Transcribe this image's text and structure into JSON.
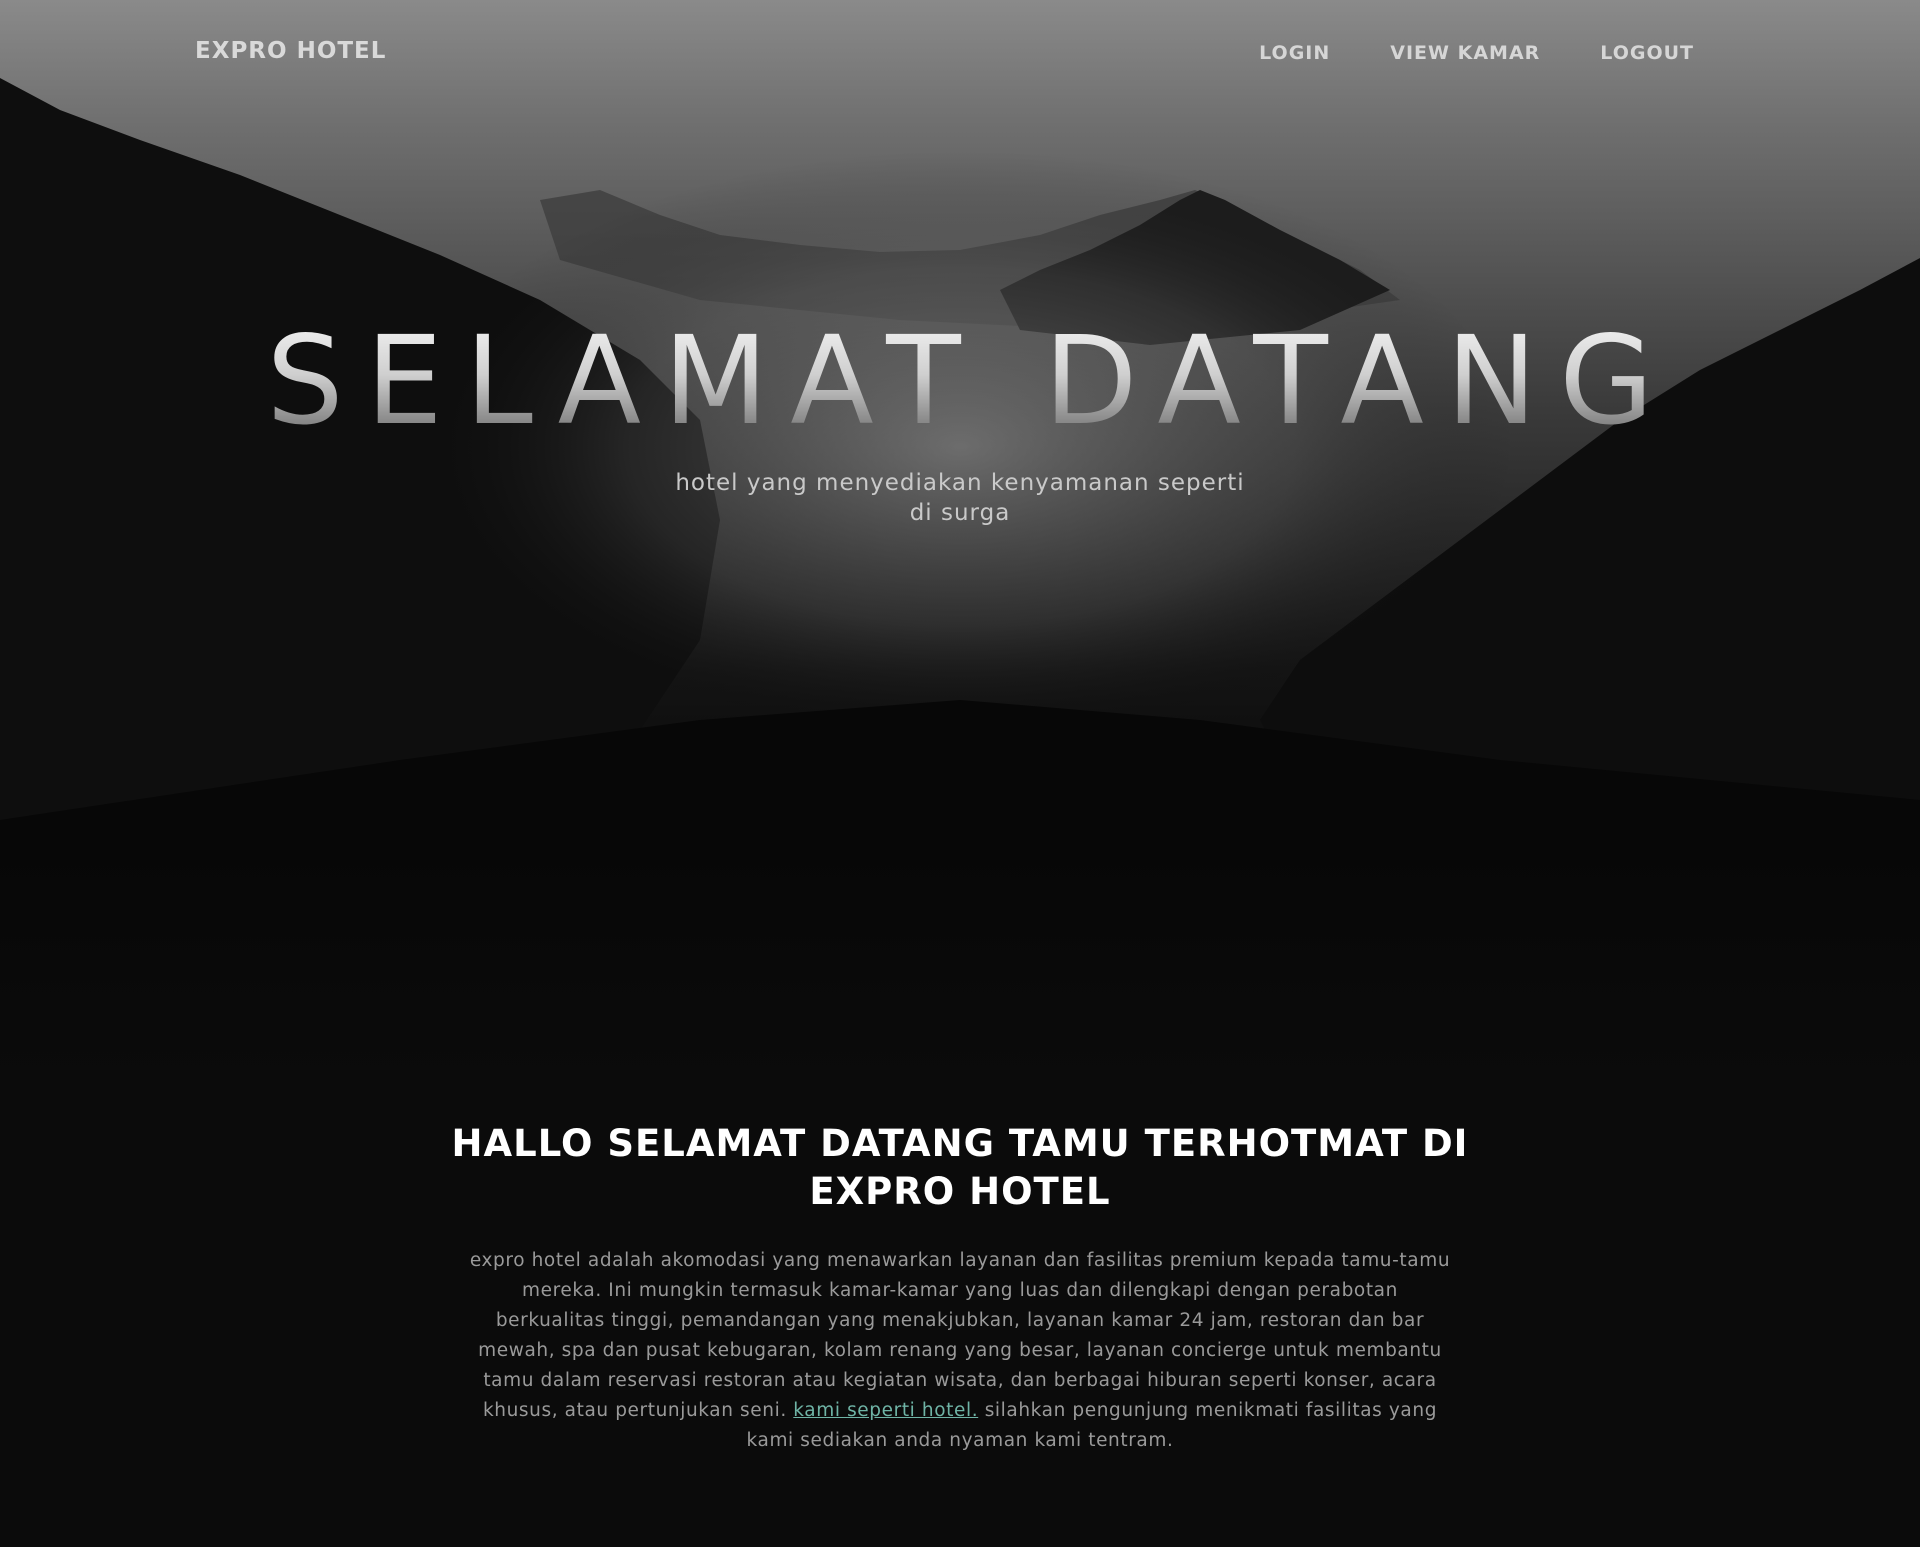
{
  "nav": {
    "brand": "EXPRO HOTEL",
    "links": [
      {
        "label": "LOGIN"
      },
      {
        "label": "VIEW KAMAR"
      },
      {
        "label": "LOGOUT"
      }
    ]
  },
  "hero": {
    "title": "SELAMAT DATANG",
    "subtitle": "hotel yang menyediakan kenyamanan seperti di surga"
  },
  "about": {
    "title": "HALLO SELAMAT DATANG TAMU TERHOTMAT DI EXPRO HOTEL",
    "text_before": "expro hotel adalah akomodasi yang menawarkan layanan dan fasilitas premium kepada tamu-tamu mereka. Ini mungkin termasuk kamar-kamar yang luas dan dilengkapi dengan perabotan berkualitas tinggi, pemandangan yang menakjubkan, layanan kamar 24 jam, restoran dan bar mewah, spa dan pusat kebugaran, kolam renang yang besar, layanan concierge untuk membantu tamu dalam reservasi restoran atau kegiatan wisata, dan berbagai hiburan seperti konser, acara khusus, atau pertunjukan seni.",
    "link_text": "kami seperti hotel.",
    "text_after": "silahkan pengunjung menikmati fasilitas yang kami sediakan anda nyaman kami tentram."
  },
  "colors": {
    "background": "#0b0b0b",
    "link": "#6fb4a6",
    "nav_text": "#d6d6d6"
  }
}
